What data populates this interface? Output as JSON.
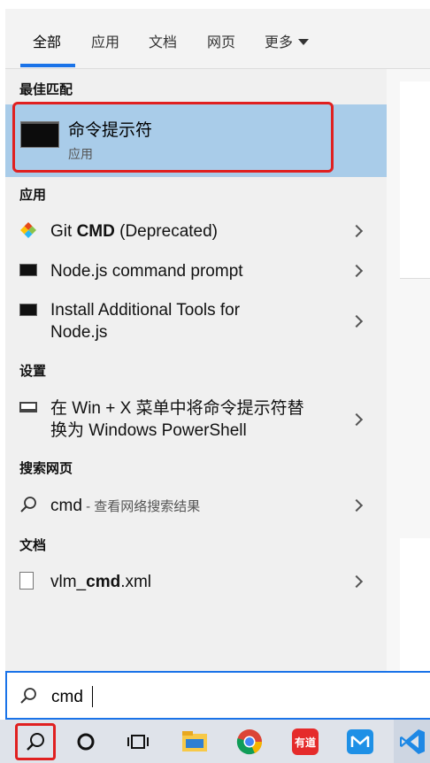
{
  "tabs": [
    {
      "label": "全部",
      "active": true
    },
    {
      "label": "应用",
      "active": false
    },
    {
      "label": "文档",
      "active": false
    },
    {
      "label": "网页",
      "active": false
    },
    {
      "label": "更多",
      "active": false
    }
  ],
  "sections": {
    "best_match": "最佳匹配",
    "apps": "应用",
    "settings": "设置",
    "web": "搜索网页",
    "docs": "文档"
  },
  "best_match": {
    "title": "命令提示符",
    "subtitle": "应用"
  },
  "apps": [
    {
      "pre": "Git ",
      "bold": "CMD",
      "post": " (Deprecated)",
      "icon": "git-icon"
    },
    {
      "line1": "Node.js command prompt",
      "icon": "terminal-icon"
    },
    {
      "line1": "Install Additional Tools for",
      "line2": "Node.js",
      "icon": "terminal-icon"
    }
  ],
  "settings_item": {
    "line1": "在 Win + X 菜单中将命令提示符替",
    "line2": "换为 Windows PowerShell",
    "icon": "window-icon"
  },
  "web_item": {
    "term": "cmd",
    "suffix": " - 查看网络搜索结果",
    "icon": "search-icon"
  },
  "doc_item": {
    "pre": "vlm_",
    "bold": "cmd",
    "post": ".xml",
    "icon": "xml-file-icon"
  },
  "search": {
    "value": "cmd"
  },
  "taskbar": [
    "search-icon",
    "cortana-icon",
    "task-view-icon",
    "file-explorer-icon",
    "chrome-icon",
    "youdao-icon",
    "mail-icon",
    "vscode-icon"
  ],
  "youdao_label": "有道",
  "colors": {
    "accent": "#1a73e8",
    "selection": "#a9cce9",
    "highlight_box": "#e02020"
  }
}
